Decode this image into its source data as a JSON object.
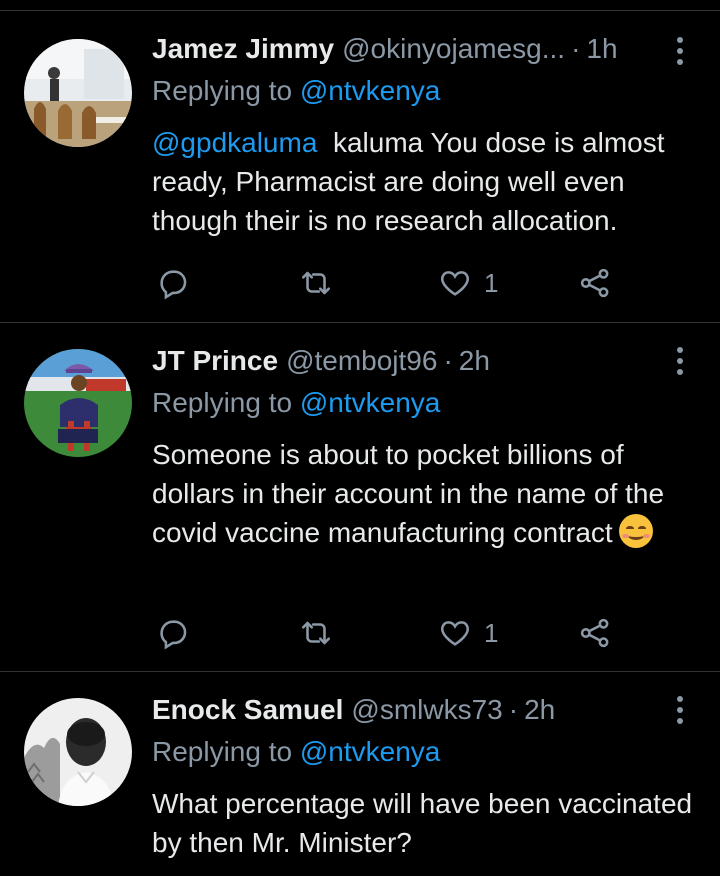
{
  "colors": {
    "background": "#000000",
    "text": "#e7e9ea",
    "muted": "#8b98a5",
    "link": "#1d9bf0",
    "divider": "#2f3336"
  },
  "tweets": [
    {
      "name": "Jamez Jimmy",
      "handle": "@okinyojamesg...",
      "separator": "·",
      "time": "1h",
      "replying_prefix": "Replying to ",
      "replying_to": "@ntvkenya",
      "mention": "@gpdkaluma",
      "text": "  kaluma You dose is almost ready, Pharmacist are doing well even though their is no research allocation.",
      "actions": {
        "reply_icon": "reply-icon",
        "retweet_icon": "retweet-icon",
        "like_icon": "heart-icon",
        "like_count": "1",
        "share_icon": "share-icon"
      }
    },
    {
      "name": "JT Prince",
      "handle": "@tembojt96",
      "separator": "·",
      "time": "2h",
      "replying_prefix": "Replying to ",
      "replying_to": "@ntvkenya",
      "text": "Someone is about to pocket billions of dollars in their account in the name of the covid vaccine manufacturing contract",
      "emoji": "smiling-face-emoji",
      "actions": {
        "reply_icon": "reply-icon",
        "retweet_icon": "retweet-icon",
        "like_icon": "heart-icon",
        "like_count": "1",
        "share_icon": "share-icon"
      }
    },
    {
      "name": "Enock Samuel",
      "handle": "@smlwks73",
      "separator": "·",
      "time": "2h",
      "replying_prefix": "Replying to ",
      "replying_to": "@ntvkenya",
      "text": "What percentage will have been vaccinated by then Mr. Minister?"
    }
  ]
}
